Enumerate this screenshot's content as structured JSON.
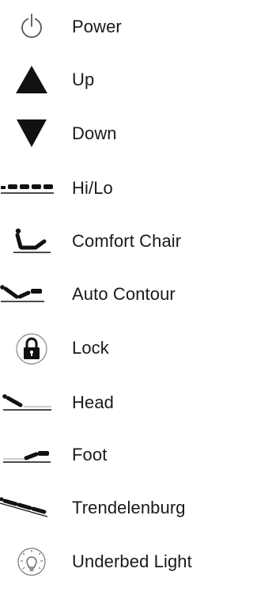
{
  "legend": {
    "items": [
      {
        "icon": "power-icon",
        "label": "Power"
      },
      {
        "icon": "up-arrow-icon",
        "label": "Up"
      },
      {
        "icon": "down-arrow-icon",
        "label": "Down"
      },
      {
        "icon": "hi-lo-icon",
        "label": "Hi/Lo"
      },
      {
        "icon": "comfort-chair-icon",
        "label": "Comfort Chair"
      },
      {
        "icon": "auto-contour-icon",
        "label": "Auto Contour"
      },
      {
        "icon": "lock-icon",
        "label": "Lock"
      },
      {
        "icon": "head-icon",
        "label": "Head"
      },
      {
        "icon": "foot-icon",
        "label": "Foot"
      },
      {
        "icon": "trendelenburg-icon",
        "label": "Trendelenburg"
      },
      {
        "icon": "underbed-light-icon",
        "label": "Underbed Light"
      }
    ],
    "colors": {
      "icon": "#111111",
      "text": "#1a1a1a"
    }
  }
}
